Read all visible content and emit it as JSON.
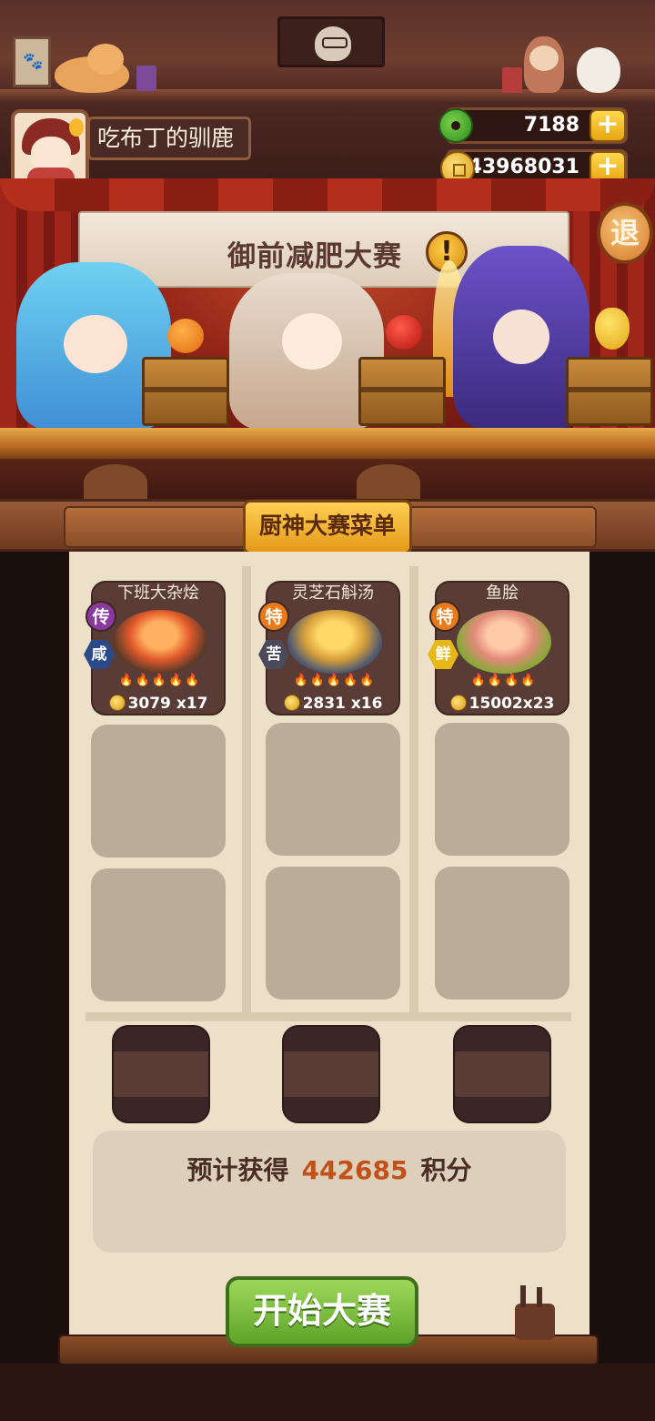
{
  "player": {
    "name": "吃布丁的驯鹿"
  },
  "currency": {
    "jade": "7188",
    "coins": "43968031",
    "plus_label": "+"
  },
  "event": {
    "title": "御前减肥大赛",
    "alert": "!",
    "exit_label": "退"
  },
  "menu": {
    "title": "厨神大赛菜单",
    "dishes": [
      {
        "name": "下班大杂烩",
        "rank": "传",
        "flavor": "咸",
        "price": "3079",
        "qty": "x17",
        "heat": "🔥🔥🔥🔥🔥"
      },
      {
        "name": "灵芝石斛汤",
        "rank": "特",
        "flavor": "苦",
        "price": "2831",
        "qty": "x16",
        "heat": "🔥🔥🔥🔥🔥"
      },
      {
        "name": "鱼脍",
        "rank": "特",
        "flavor": "鲜",
        "price": "15002",
        "qty": "x23",
        "heat": "🔥🔥🔥🔥"
      }
    ]
  },
  "score": {
    "prefix": "预计获得",
    "value": "442685",
    "suffix": "积分"
  },
  "start_button": "开始大赛",
  "colors": {
    "accent_orange": "#c2501a",
    "start_green": "#5ea32a",
    "gold": "#e59a18"
  }
}
